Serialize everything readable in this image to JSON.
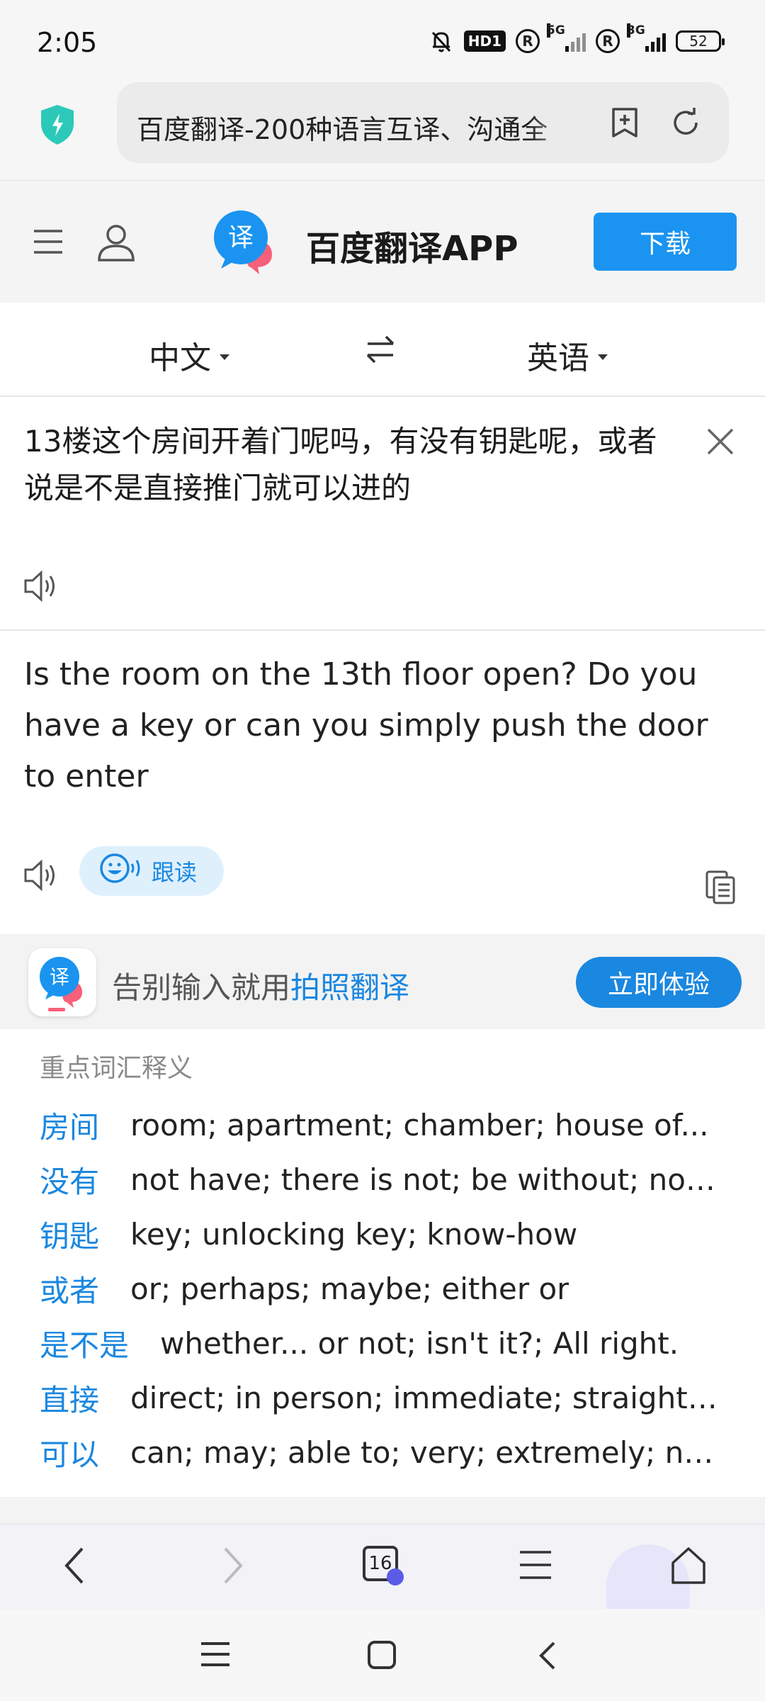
{
  "status_bar": {
    "time": "2:05",
    "hd_label": "HD1",
    "signal1_label": "5G",
    "signal2_label": "3G",
    "battery": "52"
  },
  "browser": {
    "url_title": "百度翻译-200种语言互译、沟通全",
    "tab_count": "16"
  },
  "app_header": {
    "title": "百度翻译APP",
    "download_label": "下载"
  },
  "language": {
    "source": "中文",
    "target": "英语"
  },
  "source": {
    "text": "13楼这个房间开着门呢吗，有没有钥匙呢，或者说是不是直接推门就可以进的"
  },
  "result": {
    "text": "Is the room on the 13th floor open? Do you have a key or can you simply push the door to enter",
    "follow_read_label": "跟读"
  },
  "promo": {
    "text_prefix": "告别输入就用",
    "text_highlight": "拍照翻译",
    "button_label": "立即体验"
  },
  "vocab": {
    "heading": "重点词汇释义",
    "items": [
      {
        "word": "房间",
        "definition": "room; apartment; chamber; house of..."
      },
      {
        "word": "没有",
        "definition": "not have; there is not; be without; not..."
      },
      {
        "word": "钥匙",
        "definition": "key; unlocking key; know-how"
      },
      {
        "word": "或者",
        "definition": "or; perhaps; maybe; either or"
      },
      {
        "word": "是不是",
        "definition": "whether... or not; isn't it?; All right."
      },
      {
        "word": "直接",
        "definition": "direct; in person; immediate; straightforward"
      },
      {
        "word": "可以",
        "definition": "can; may; able to; very; extremely; not bad"
      }
    ]
  },
  "colors": {
    "accent": "#1a87e0",
    "download_button": "#1a94f0",
    "shield": "#2cc9b8"
  }
}
